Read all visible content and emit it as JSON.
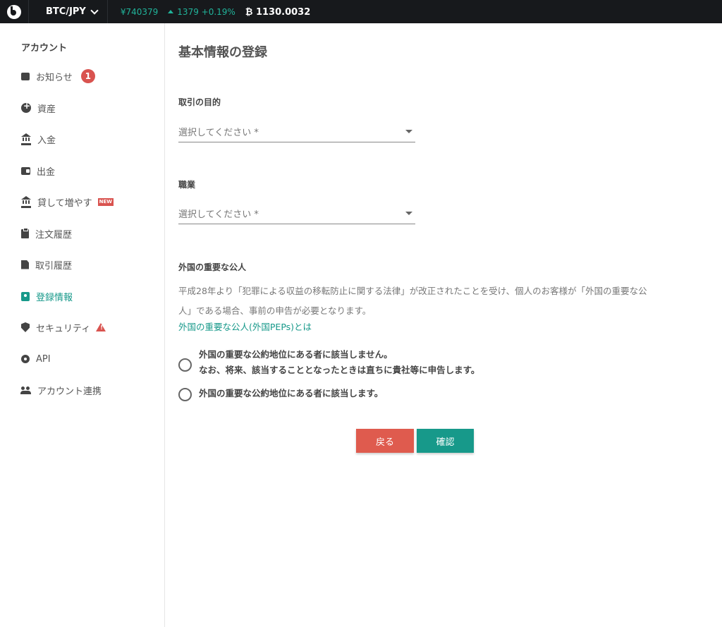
{
  "topbar": {
    "pair": "BTC/JPY",
    "price": "¥740379",
    "change": "1379 +0.19%",
    "btc_balance": "1130.0032"
  },
  "sidebar": {
    "heading": "アカウント",
    "items": [
      {
        "label": "お知らせ",
        "icon": "chat-icon",
        "badge": "1"
      },
      {
        "label": "資産",
        "icon": "plus-circle-icon"
      },
      {
        "label": "入金",
        "icon": "bank-icon"
      },
      {
        "label": "出金",
        "icon": "wallet-icon"
      },
      {
        "label": "貸して増やす",
        "icon": "bank-icon",
        "badge": "NEW"
      },
      {
        "label": "注文履歴",
        "icon": "clipboard-icon"
      },
      {
        "label": "取引履歴",
        "icon": "document-icon"
      },
      {
        "label": "登録情報",
        "icon": "badge-icon",
        "active": true
      },
      {
        "label": "セキュリティ",
        "icon": "shield-icon",
        "warning": "!"
      },
      {
        "label": "API",
        "icon": "gear-icon"
      },
      {
        "label": "アカウント連携",
        "icon": "people-icon"
      }
    ]
  },
  "main": {
    "title": "基本情報の登録",
    "purpose": {
      "label": "取引の目的",
      "placeholder": "選択してください *"
    },
    "occupation": {
      "label": "職業",
      "placeholder": "選択してください *"
    },
    "peps": {
      "label": "外国の重要な公人",
      "description": "平成28年より「犯罪による収益の移転防止に関する法律」が改正されたことを受け、個人のお客様が「外国の重要な公人」である場合、事前の申告が必要となります。",
      "link": "外国の重要な公人(外国PEPs)とは",
      "option1_line1": "外国の重要な公約地位にある者に該当しません。",
      "option1_line2": "なお、将来、該当することとなったときは直ちに貴社等に申告します。",
      "option2": "外国の重要な公約地位にある者に該当します。"
    },
    "buttons": {
      "back": "戻る",
      "confirm": "確認"
    }
  },
  "colors": {
    "accent": "#17998a",
    "danger": "#df5b4e",
    "topbar": "#17191c"
  }
}
